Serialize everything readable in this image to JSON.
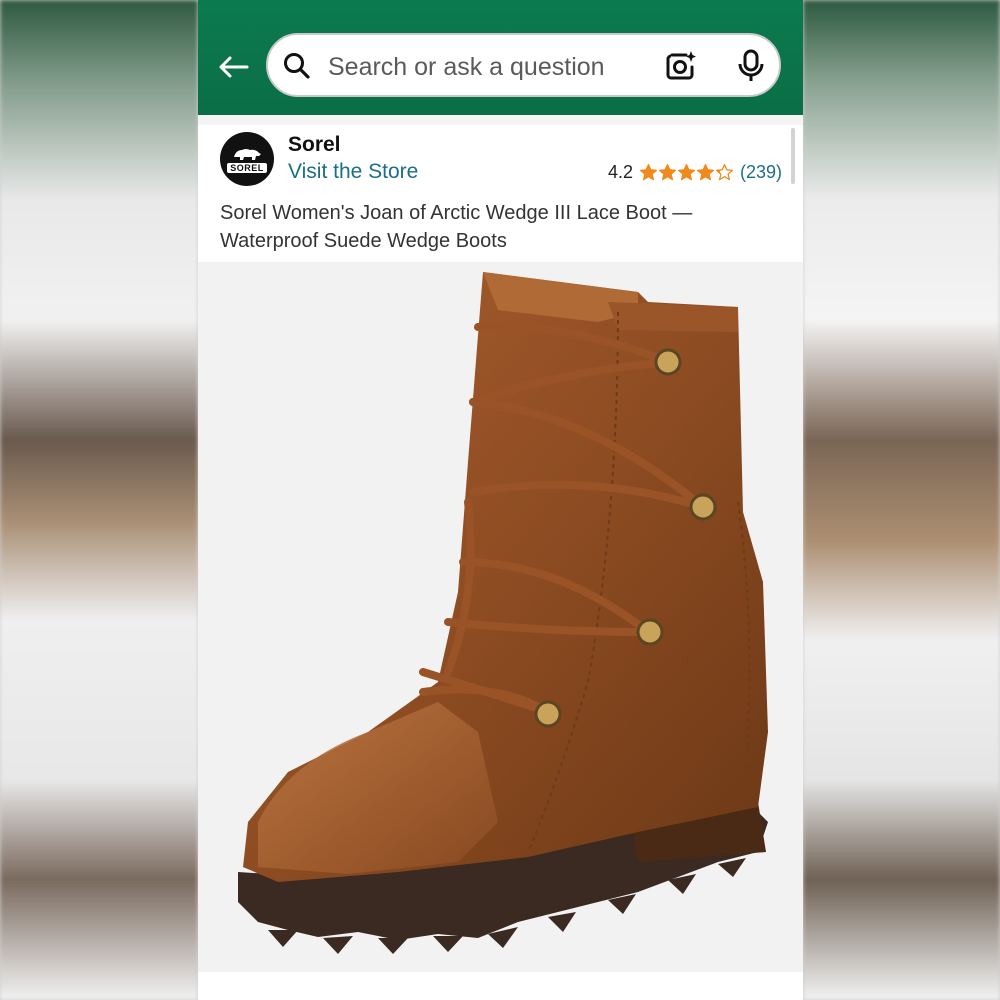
{
  "header": {
    "search_placeholder": "Search or ask a question",
    "back_icon": "back-arrow-icon",
    "camera_icon": "camera-lens-icon",
    "mic_icon": "microphone-icon",
    "bg_color": "#0a6e47"
  },
  "store": {
    "brand": "Sorel",
    "logo_text": "SOREL",
    "visit_label": "Visit the Store",
    "rating_value": "4.2",
    "rating_stars": 4.2,
    "review_count": "(239)",
    "star_color": "#f08a1c"
  },
  "product": {
    "title_line1": "Sorel Women's Joan of Arctic Wedge III Lace Boot —",
    "title_line2": "Waterproof Suede Wedge Boots",
    "image": "brown-leather-wedge-lace-boot-photo"
  }
}
